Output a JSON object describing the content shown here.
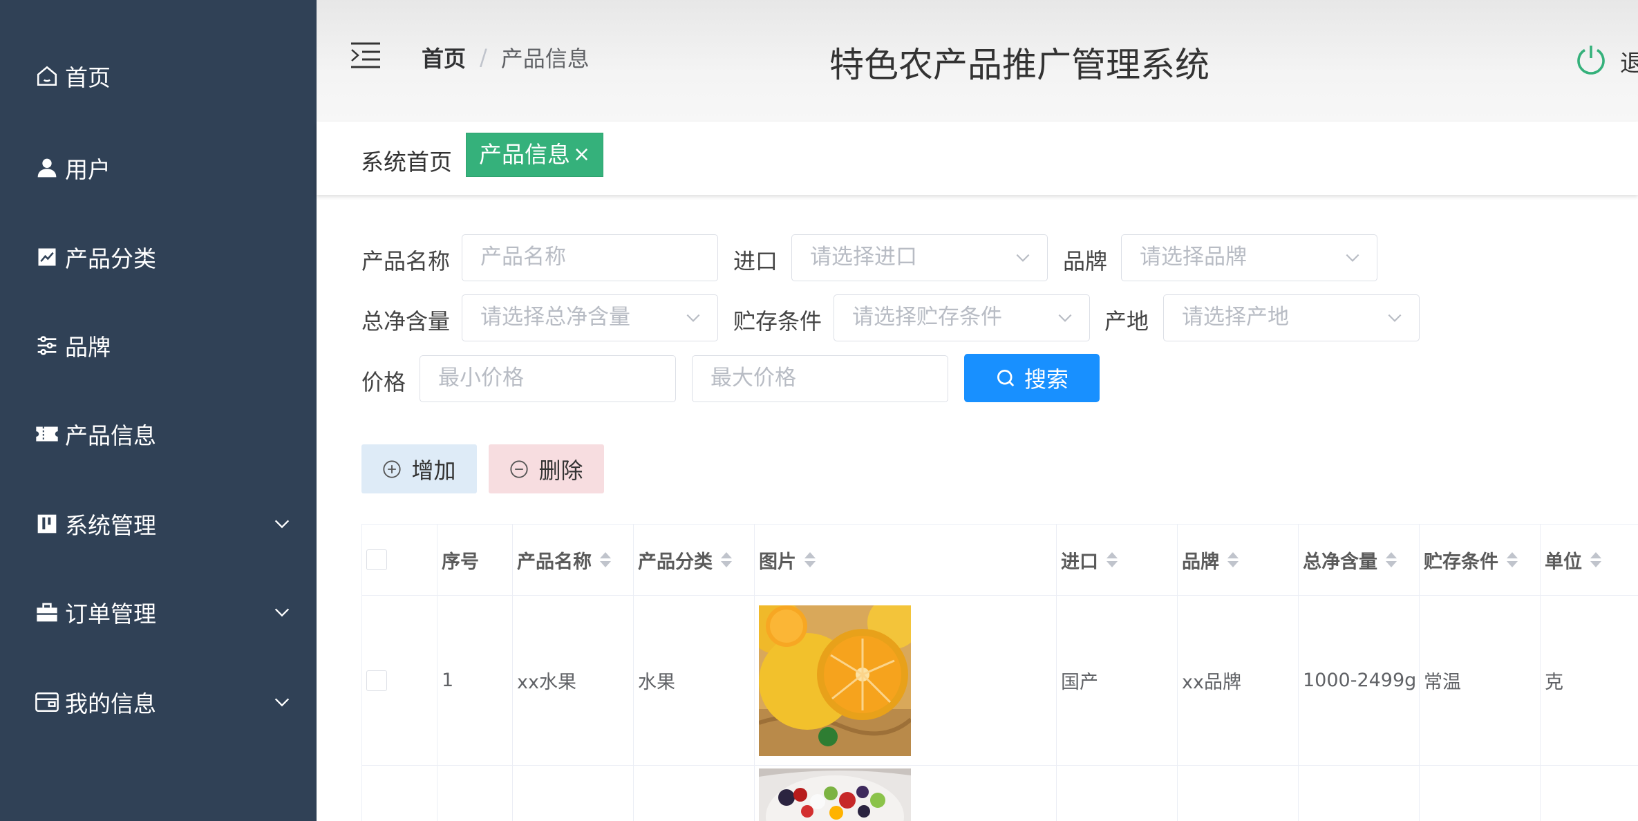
{
  "sidebar": {
    "items": [
      {
        "label": "首页",
        "icon": "home-icon"
      },
      {
        "label": "用户",
        "icon": "user-icon"
      },
      {
        "label": "产品分类",
        "icon": "chart-icon"
      },
      {
        "label": "品牌",
        "icon": "sliders-icon"
      },
      {
        "label": "产品信息",
        "icon": "ticket-icon"
      },
      {
        "label": "系统管理",
        "icon": "book-icon",
        "expandable": true
      },
      {
        "label": "订单管理",
        "icon": "briefcase-icon",
        "expandable": true
      },
      {
        "label": "我的信息",
        "icon": "wallet-icon",
        "expandable": true
      }
    ]
  },
  "header": {
    "breadcrumb_home": "首页",
    "breadcrumb_sep": "/",
    "breadcrumb_current": "产品信息",
    "title": "特色农产品推广管理系统",
    "logout_label": "退"
  },
  "tags": {
    "home": "系统首页",
    "active": "产品信息",
    "close": "×"
  },
  "filters": {
    "name_label": "产品名称",
    "name_placeholder": "产品名称",
    "import_label": "进口",
    "import_placeholder": "请选择进口",
    "brand_label": "品牌",
    "brand_placeholder": "请选择品牌",
    "net_label": "总净含量",
    "net_placeholder": "请选择总净含量",
    "storage_label": "贮存条件",
    "storage_placeholder": "请选择贮存条件",
    "origin_label": "产地",
    "origin_placeholder": "请选择产地",
    "price_label": "价格",
    "min_price_placeholder": "最小价格",
    "max_price_placeholder": "最大价格",
    "search_label": "搜索"
  },
  "actions": {
    "add_label": "增加",
    "delete_label": "删除"
  },
  "table": {
    "columns": [
      "序号",
      "产品名称",
      "产品分类",
      "图片",
      "进口",
      "品牌",
      "总净含量",
      "贮存条件",
      "单位"
    ],
    "rows": [
      {
        "index": "1",
        "name": "xx水果",
        "category": "水果",
        "import": "国产",
        "brand": "xx品牌",
        "net": "1000-2499g",
        "storage": "常温",
        "unit": "克"
      }
    ]
  },
  "colors": {
    "sidebar_bg": "#304156",
    "accent_green": "#35b17b",
    "primary_blue": "#1890ff"
  }
}
